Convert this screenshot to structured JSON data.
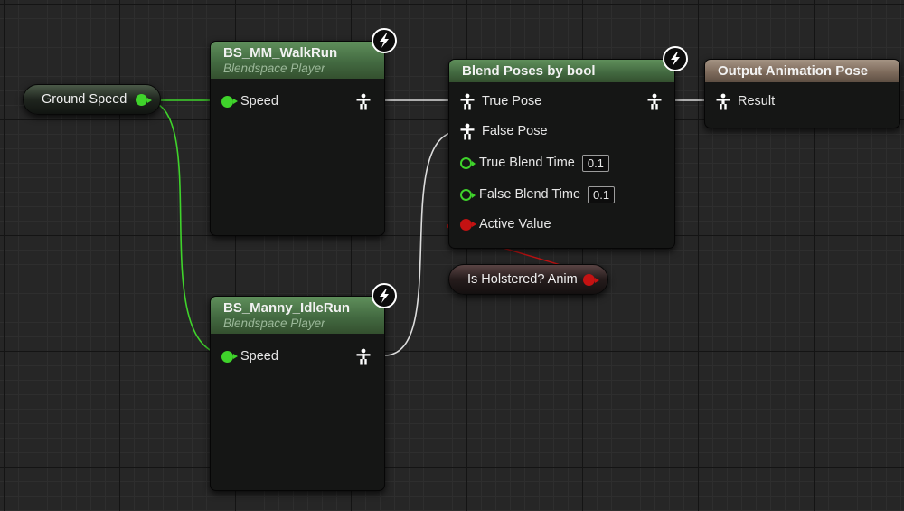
{
  "variables": {
    "ground_speed": {
      "label": "Ground Speed",
      "pin_color": "#3fd32b"
    },
    "is_holstered": {
      "label": "Is Holstered? Anim",
      "pin_color": "#c41212"
    }
  },
  "nodes": {
    "walk_run": {
      "title": "BS_MM_WalkRun",
      "subtitle": "Blendspace Player",
      "input_label": "Speed"
    },
    "idle_run": {
      "title": "BS_Manny_IdleRun",
      "subtitle": "Blendspace Player",
      "input_label": "Speed"
    },
    "blend_poses": {
      "title": "Blend Poses by bool",
      "true_pose_label": "True Pose",
      "false_pose_label": "False Pose",
      "true_blend_time_label": "True Blend Time",
      "true_blend_time_value": "0.1",
      "false_blend_time_label": "False Blend Time",
      "false_blend_time_value": "0.1",
      "active_value_label": "Active Value"
    },
    "output_pose": {
      "title": "Output Animation Pose",
      "result_label": "Result"
    }
  },
  "icons": {
    "fast_path": "lightning-bolt-icon",
    "pose_pin": "pose-pin-icon",
    "float_pin": "float-pin-icon",
    "bool_pin": "bool-pin-icon"
  },
  "colors": {
    "float_pin": "#3fd32b",
    "bool_pin": "#c41212",
    "pose_wire": "#e6e6e6",
    "anim_node_header": "#4f7a4c",
    "result_node_header": "#8f7e6e",
    "graph_background": "#262626"
  }
}
